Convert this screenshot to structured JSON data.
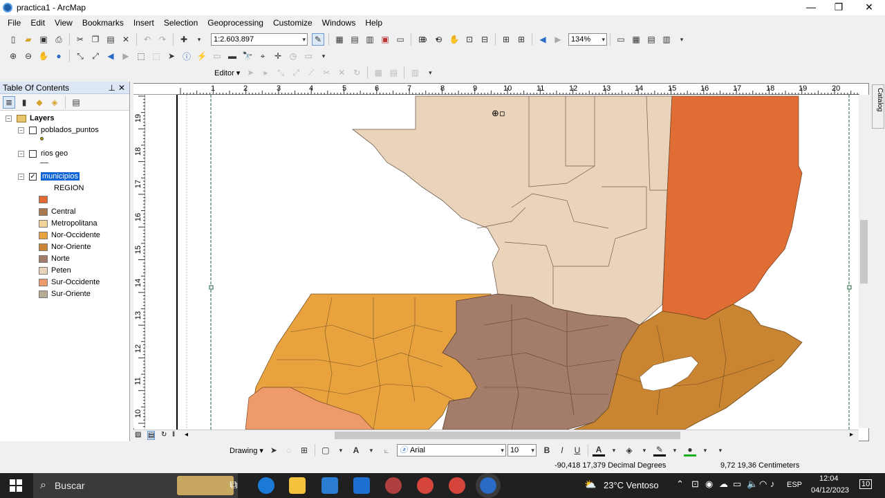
{
  "window": {
    "title": "practica1 - ArcMap",
    "minimize": "—",
    "maximize": "❐",
    "close": "✕"
  },
  "menu": [
    "File",
    "Edit",
    "View",
    "Bookmarks",
    "Insert",
    "Selection",
    "Geoprocessing",
    "Customize",
    "Windows",
    "Help"
  ],
  "toolbar": {
    "scale": "1:2.603.897",
    "zoom_percent": "134%",
    "editor": "Editor ▾"
  },
  "toc": {
    "title": "Table Of Contents",
    "root": "Layers",
    "layers": [
      {
        "name": "poblados_puntos",
        "checked": false
      },
      {
        "name": "rios geo",
        "checked": false
      },
      {
        "name": "municipios",
        "checked": true
      }
    ],
    "field": "REGION",
    "legend": [
      {
        "label": "",
        "color": "#e06a32"
      },
      {
        "label": "Central",
        "color": "#a8784e"
      },
      {
        "label": "Metropolitana",
        "color": "#f3d49a"
      },
      {
        "label": "Nor-Occidente",
        "color": "#e8a23e"
      },
      {
        "label": "Nor-Oriente",
        "color": "#c98532"
      },
      {
        "label": "Norte",
        "color": "#a47c6a"
      },
      {
        "label": "Peten",
        "color": "#ead3bb"
      },
      {
        "label": "Sur-Occidente",
        "color": "#ee9a6a"
      },
      {
        "label": "Sur-Oriente",
        "color": "#b8ac96"
      }
    ]
  },
  "rulers": {
    "h": [
      "1",
      "2",
      "3",
      "4",
      "5",
      "6",
      "7",
      "8",
      "9",
      "10",
      "11",
      "12",
      "13",
      "14",
      "15",
      "16",
      "17",
      "18",
      "19",
      "20"
    ],
    "v": [
      "19",
      "18",
      "17",
      "16",
      "15",
      "14",
      "13",
      "12",
      "11",
      "10"
    ]
  },
  "catalog_tab": "Catalog",
  "drawing": {
    "menu": "Drawing ▾",
    "font": "Arial",
    "size": "10",
    "bold": "B",
    "italic": "I",
    "underline": "U"
  },
  "status": {
    "coords": "-90,418  17,379 Decimal Degrees",
    "page": "9,72  19,36 Centimeters"
  },
  "taskbar": {
    "search": "Buscar",
    "weather": "23°C  Ventoso",
    "lang": "ESP",
    "time": "12:04",
    "date": "04/12/2023",
    "notif": "10"
  }
}
